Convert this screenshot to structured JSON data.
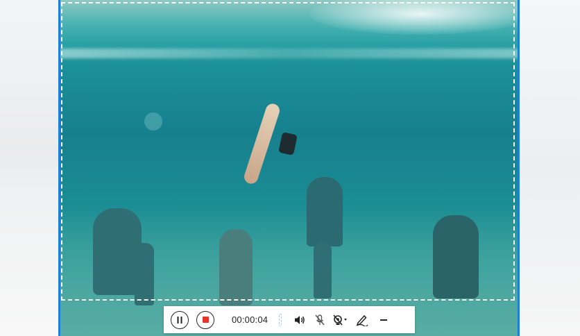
{
  "toolbar": {
    "timer": "00:00:04",
    "icons": {
      "pause": "pause-icon",
      "stop": "stop-icon",
      "volume_level": "volume-level-icon",
      "speaker": "speaker-icon",
      "microphone": "microphone-off-icon",
      "webcam": "webcam-off-icon",
      "annotate": "pen-icon",
      "minimize": "minimize-icon"
    }
  },
  "colors": {
    "frame_accent": "#1e7fd6",
    "stop_red": "#e8332a",
    "scene_teal": "#1a8e98"
  }
}
